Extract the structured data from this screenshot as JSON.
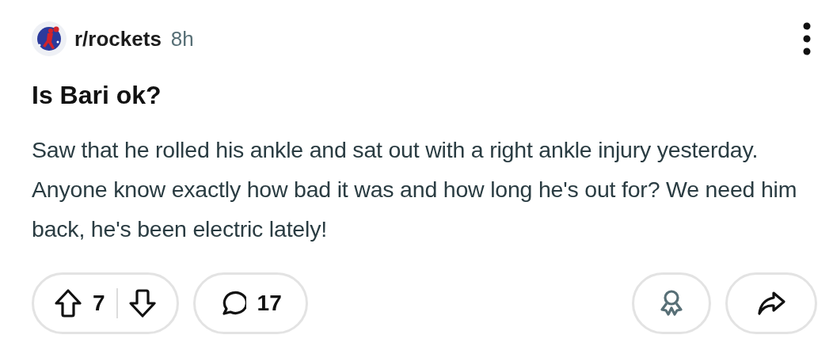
{
  "post": {
    "subreddit": "r/rockets",
    "age": "8h",
    "title": "Is Bari ok?",
    "body": "Saw that he rolled his ankle and sat out with a right ankle injury yesterday. Anyone know exactly how bad it was and how long he's out for? We need him back, he's been electric lately!"
  },
  "actions": {
    "votes": "7",
    "comments": "17"
  }
}
